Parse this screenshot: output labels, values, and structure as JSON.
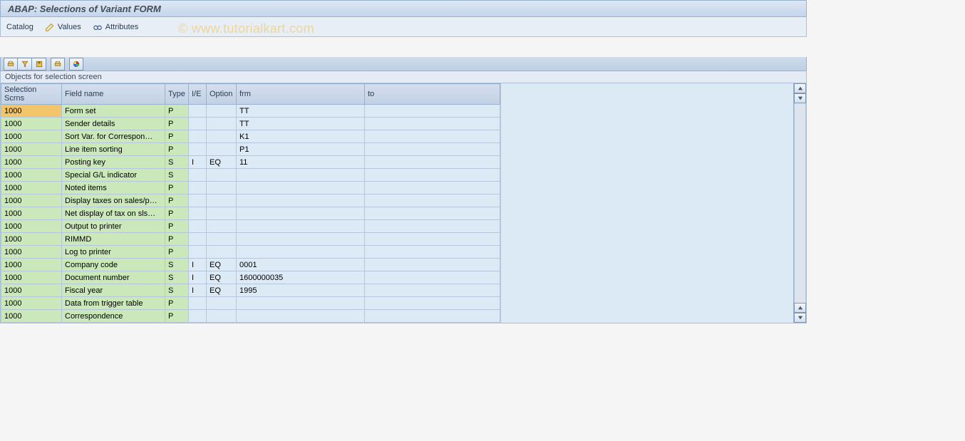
{
  "header": {
    "title": "ABAP: Selections of Variant FORM"
  },
  "watermark": "© www.tutorialkart.com",
  "toolbar": {
    "catalog": "Catalog",
    "values": "Values",
    "attributes": "Attributes"
  },
  "group_label": "Objects for selection screen",
  "columns": {
    "scr": "Selection Scrns",
    "fname": "Field name",
    "type": "Type",
    "ie": "I/E",
    "option": "Option",
    "frm": "frm",
    "to": "to"
  },
  "rows": [
    {
      "scr": "1000",
      "sel": true,
      "fname": "Form set",
      "type": "P",
      "ie": "",
      "opt": "",
      "frm": "TT",
      "to": ""
    },
    {
      "scr": "1000",
      "sel": false,
      "fname": "Sender details",
      "type": "P",
      "ie": "",
      "opt": "",
      "frm": "TT",
      "to": ""
    },
    {
      "scr": "1000",
      "sel": false,
      "fname": "Sort Var. for Correspon…",
      "type": "P",
      "ie": "",
      "opt": "",
      "frm": "K1",
      "to": ""
    },
    {
      "scr": "1000",
      "sel": false,
      "fname": "Line item sorting",
      "type": "P",
      "ie": "",
      "opt": "",
      "frm": "P1",
      "to": ""
    },
    {
      "scr": "1000",
      "sel": false,
      "fname": "Posting key",
      "type": "S",
      "ie": "I",
      "opt": "EQ",
      "frm": "11",
      "to": ""
    },
    {
      "scr": "1000",
      "sel": false,
      "fname": "Special G/L indicator",
      "type": "S",
      "ie": "",
      "opt": "",
      "frm": "",
      "to": ""
    },
    {
      "scr": "1000",
      "sel": false,
      "fname": "Noted items",
      "type": "P",
      "ie": "",
      "opt": "",
      "frm": "",
      "to": ""
    },
    {
      "scr": "1000",
      "sel": false,
      "fname": "Display taxes on sales/p…",
      "type": "P",
      "ie": "",
      "opt": "",
      "frm": "",
      "to": ""
    },
    {
      "scr": "1000",
      "sel": false,
      "fname": "Net display of tax on sls…",
      "type": "P",
      "ie": "",
      "opt": "",
      "frm": "",
      "to": ""
    },
    {
      "scr": "1000",
      "sel": false,
      "fname": "Output to printer",
      "type": "P",
      "ie": "",
      "opt": "",
      "frm": "",
      "to": ""
    },
    {
      "scr": "1000",
      "sel": false,
      "fname": "RIMMD",
      "type": "P",
      "ie": "",
      "opt": "",
      "frm": "",
      "to": ""
    },
    {
      "scr": "1000",
      "sel": false,
      "fname": "Log to printer",
      "type": "P",
      "ie": "",
      "opt": "",
      "frm": "",
      "to": ""
    },
    {
      "scr": "1000",
      "sel": false,
      "fname": "Company code",
      "type": "S",
      "ie": "I",
      "opt": "EQ",
      "frm": "0001",
      "to": ""
    },
    {
      "scr": "1000",
      "sel": false,
      "fname": "Document number",
      "type": "S",
      "ie": "I",
      "opt": "EQ",
      "frm": "1600000035",
      "to": ""
    },
    {
      "scr": "1000",
      "sel": false,
      "fname": "Fiscal year",
      "type": "S",
      "ie": "I",
      "opt": "EQ",
      "frm": "1995",
      "to": ""
    },
    {
      "scr": "1000",
      "sel": false,
      "fname": "Data from trigger table",
      "type": "P",
      "ie": "",
      "opt": "",
      "frm": "",
      "to": ""
    },
    {
      "scr": "1000",
      "sel": false,
      "fname": "Correspondence",
      "type": "P",
      "ie": "",
      "opt": "",
      "frm": "",
      "to": ""
    }
  ]
}
